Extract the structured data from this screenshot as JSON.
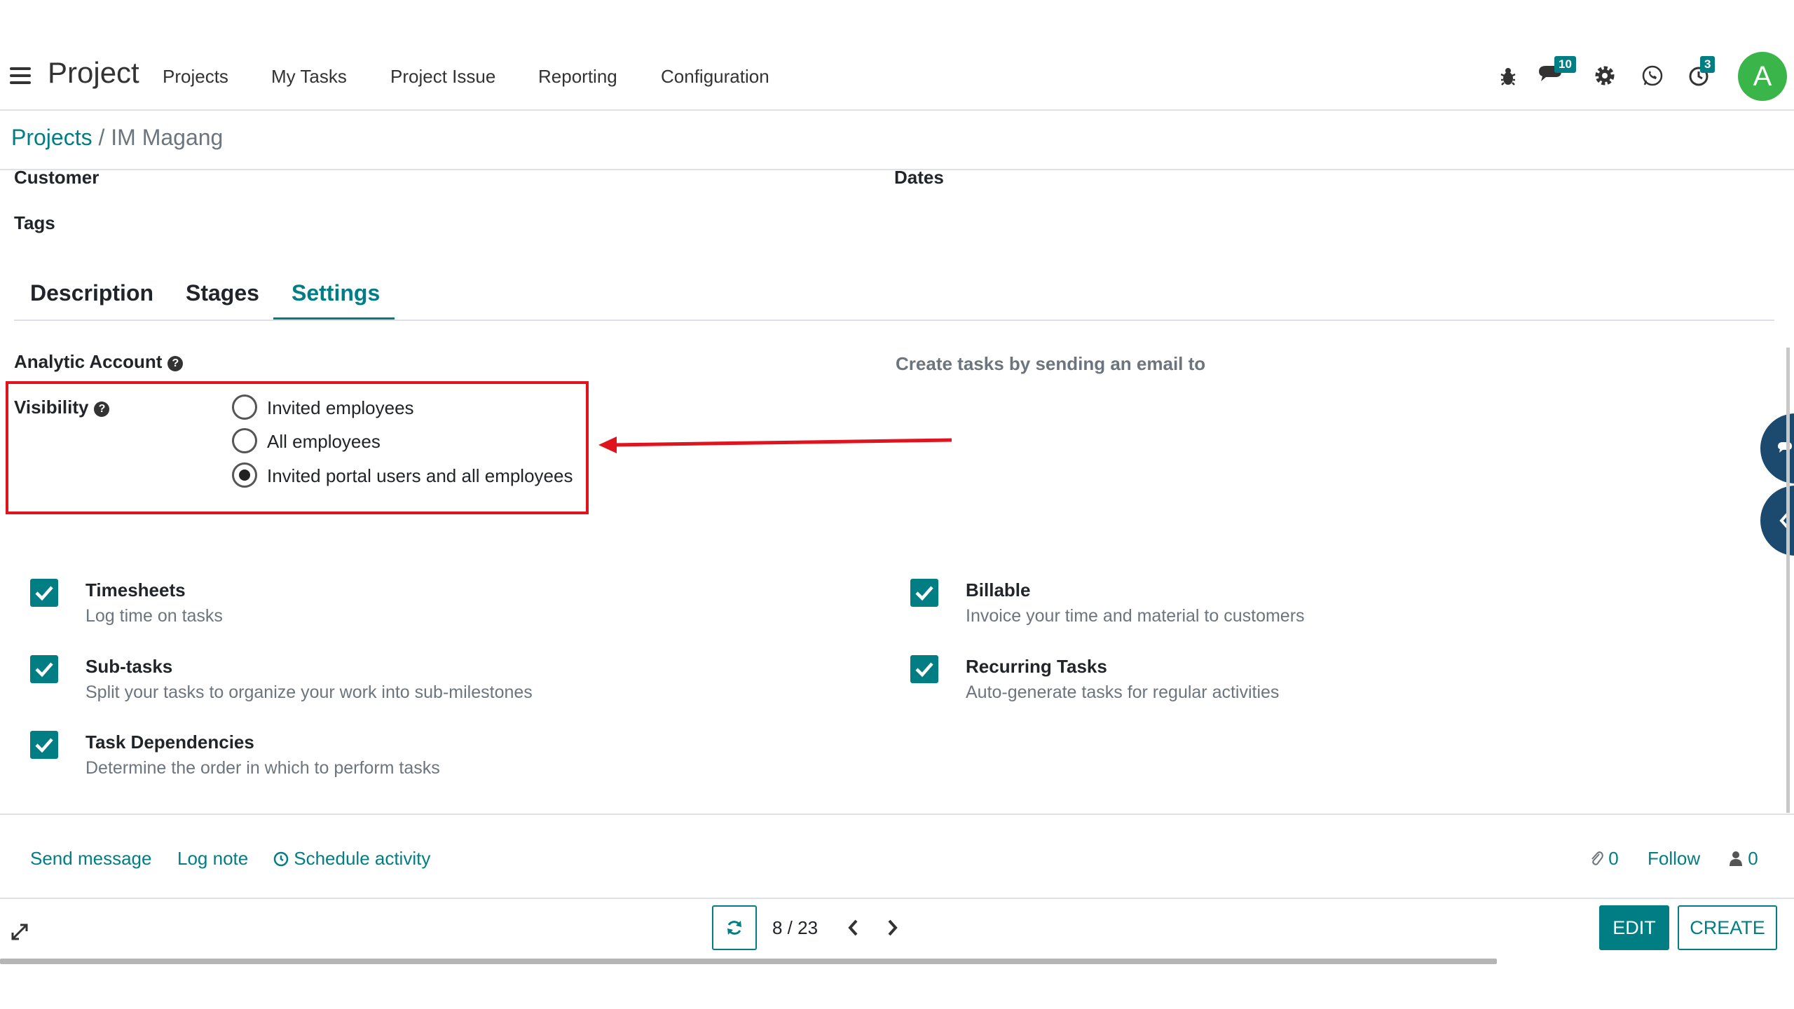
{
  "app": {
    "title": "Project"
  },
  "nav": {
    "items": [
      "Projects",
      "My Tasks",
      "Project Issue",
      "Reporting",
      "Configuration"
    ]
  },
  "systray": {
    "messages_badge": "10",
    "activities_badge": "3",
    "avatar_letter": "A"
  },
  "breadcrumb": {
    "parent": "Projects",
    "separator": "/",
    "current": "IM Magang"
  },
  "form": {
    "customer_label": "Customer",
    "dates_label": "Dates",
    "tags_label": "Tags"
  },
  "tabs": [
    "Description",
    "Stages",
    "Settings"
  ],
  "settings": {
    "analytic_account_label": "Analytic Account",
    "email_label": "Create tasks by sending an email to",
    "visibility_label": "Visibility",
    "help_glyph": "?",
    "visibility_options": [
      "Invited employees",
      "All employees",
      "Invited portal users and all employees"
    ],
    "visibility_selected": "Invited portal users and all employees",
    "options": [
      {
        "title": "Timesheets",
        "desc": "Log time on tasks",
        "checked": true
      },
      {
        "title": "Billable",
        "desc": "Invoice your time and material to customers",
        "checked": true
      },
      {
        "title": "Sub-tasks",
        "desc": "Split your tasks to organize your work into sub-milestones",
        "checked": true
      },
      {
        "title": "Recurring Tasks",
        "desc": "Auto-generate tasks for regular activities",
        "checked": true
      },
      {
        "title": "Task Dependencies",
        "desc": "Determine the order in which to perform tasks",
        "checked": true
      }
    ]
  },
  "chatter": {
    "send_message": "Send message",
    "log_note": "Log note",
    "schedule_activity": "Schedule activity",
    "attachments_count": "0",
    "follow": "Follow",
    "followers_count": "0"
  },
  "pager": {
    "value": "8 / 23"
  },
  "buttons": {
    "edit": "EDIT",
    "create": "CREATE"
  },
  "colors": {
    "accent": "#017e84",
    "highlight_box": "#e0141e",
    "avatar": "#3ab54a",
    "side_panel": "#1c4a6e"
  },
  "icons": [
    "menu-icon",
    "bug-icon",
    "chat-icon",
    "gear-icon",
    "whatsapp-icon",
    "activity-clock-icon",
    "paperclip-icon",
    "user-icon",
    "clock-icon",
    "refresh-icon",
    "chevron-left-icon",
    "chevron-right-icon",
    "expand-icon"
  ]
}
